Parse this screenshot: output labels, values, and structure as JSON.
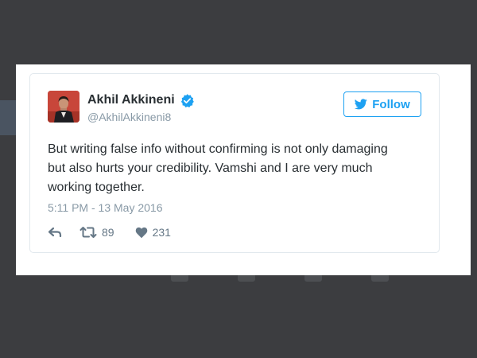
{
  "tweet": {
    "display_name": "Akhil Akkineni",
    "handle": "@AkhilAkkineni8",
    "verified": true,
    "text": "But writing false info without confirming is not only damaging but also hurts your credibility. Vamshi and I are very much working together.",
    "timestamp": "5:11 PM - 13 May 2016",
    "retweet_count": "89",
    "like_count": "231"
  },
  "follow_button": {
    "label": "Follow",
    "icon": "twitter-bird-icon"
  },
  "actions": {
    "reply_icon": "reply-icon",
    "retweet_icon": "retweet-icon",
    "like_icon": "heart-icon"
  },
  "colors": {
    "brand": "#1da1f2",
    "text": "#292f33",
    "muted": "#8899a6",
    "background": "#3c3d40"
  }
}
